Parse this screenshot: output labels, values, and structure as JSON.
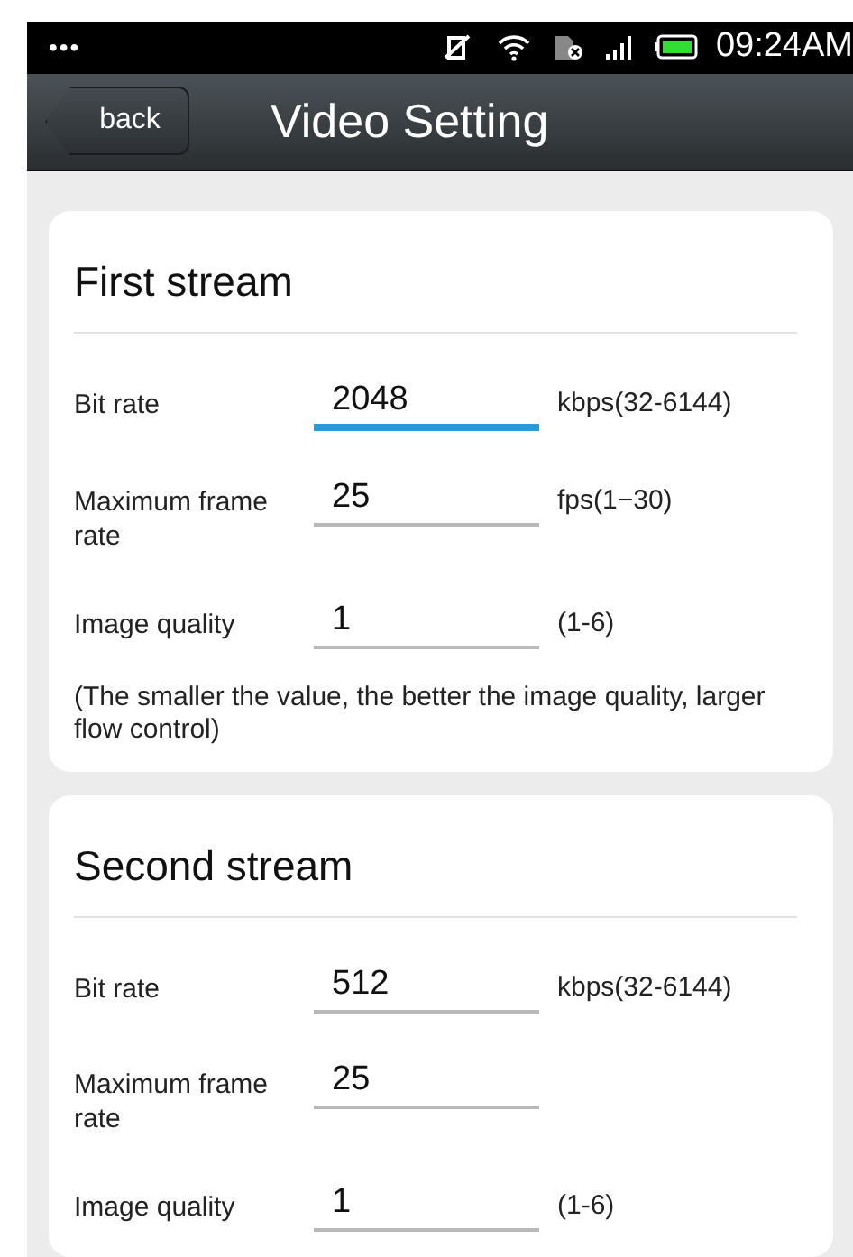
{
  "status_bar": {
    "menu": "•••",
    "time": "09:24AM"
  },
  "nav_bar": {
    "back": "back",
    "title": "Video Setting"
  },
  "streams": [
    {
      "title": "First stream",
      "fields": [
        {
          "label": "Bit rate",
          "value": "2048",
          "unit": "kbps(32-6144)",
          "focused": true
        },
        {
          "label": "Maximum frame rate",
          "value": "25",
          "unit": "fps(1−30)",
          "focused": false
        },
        {
          "label": "Image quality",
          "value": "1",
          "unit": "(1-6)",
          "focused": false
        }
      ],
      "note": "(The smaller the value, the better the image quality, larger flow control)"
    },
    {
      "title": "Second stream",
      "fields": [
        {
          "label": "Bit rate",
          "value": "512",
          "unit": "kbps(32-6144)",
          "focused": false
        },
        {
          "label": "Maximum frame rate",
          "value": "25",
          "focused": false
        },
        {
          "label": "Image quality",
          "value": "1",
          "unit": "(1-6)",
          "focused": false
        }
      ]
    }
  ]
}
